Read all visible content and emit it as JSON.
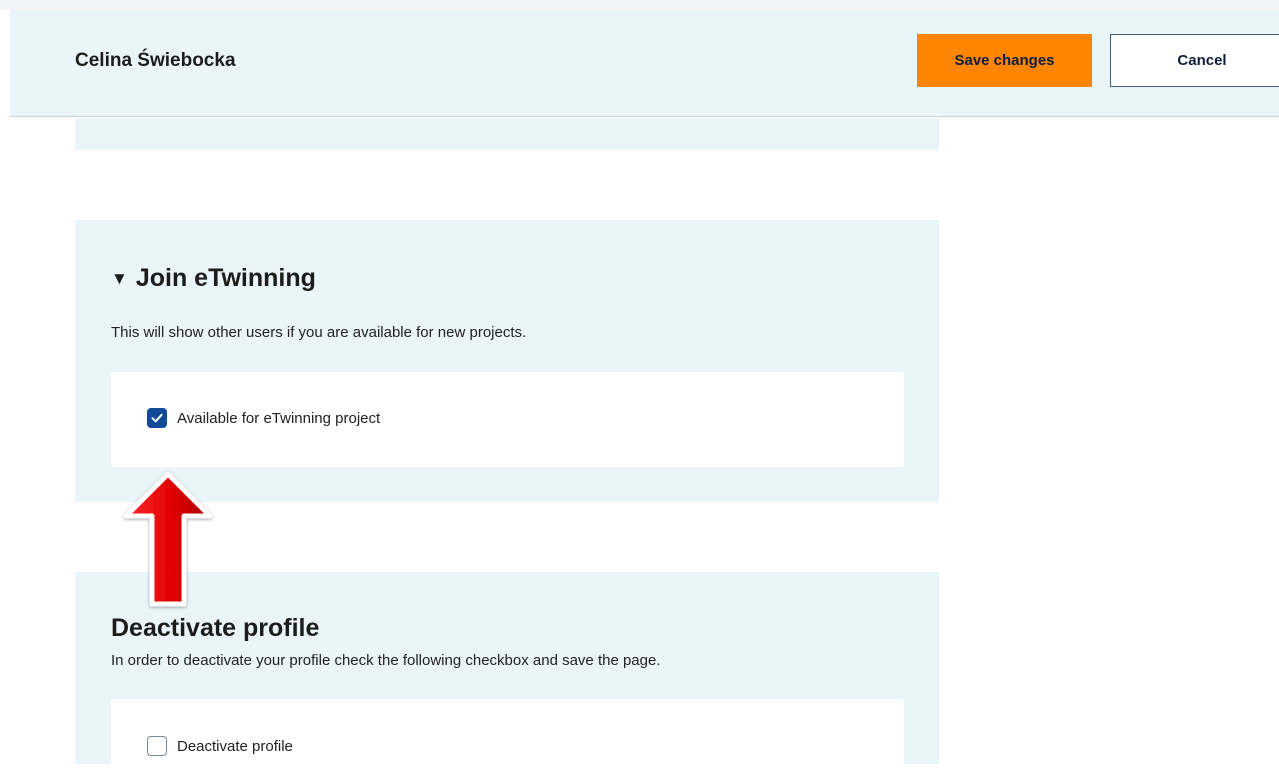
{
  "header": {
    "user_name": "Celina Świebocka",
    "save_label": "Save changes",
    "cancel_label": "Cancel"
  },
  "etwinning_section": {
    "title": "Join eTwinning",
    "caret_icon": "triangle-down-icon",
    "description": "This will show other users if you are available for new projects.",
    "checkbox": {
      "label": "Available for eTwinning project",
      "checked": true
    }
  },
  "deactivate_section": {
    "title": "Deactivate profile",
    "description": "In order to deactivate your profile check the following checkbox and save the page.",
    "checkbox": {
      "label": "Deactivate profile",
      "checked": false
    }
  },
  "colors": {
    "accent_orange": "#ff8400",
    "section_background": "#eaf5fa",
    "checkbox_checked": "#134a98",
    "annotation_arrow": "#e00000"
  }
}
